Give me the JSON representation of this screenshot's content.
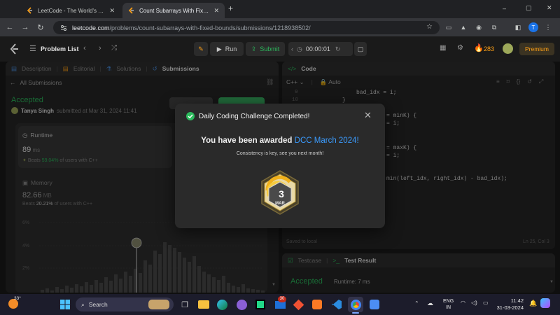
{
  "browser": {
    "tabs": [
      {
        "title": "LeetCode - The World's Leading",
        "active": false
      },
      {
        "title": "Count Subarrays With Fixed Bo",
        "active": true
      }
    ],
    "new_tab": "+",
    "url_host": "leetcode.com",
    "url_path": "/problems/count-subarrays-with-fixed-bounds/submissions/1218938502/",
    "window_controls": [
      "–",
      "▢",
      "✕"
    ],
    "profile_initial": "T"
  },
  "header": {
    "problem_list": "Problem List",
    "run": "Run",
    "submit": "Submit",
    "timer": "00:00:01",
    "streak": "283",
    "premium": "Premium"
  },
  "left": {
    "tabs": [
      "Description",
      "Editorial",
      "Solutions",
      "Submissions"
    ],
    "all_submissions": "All Submissions",
    "status": "Accepted",
    "user": "Tanya Singh",
    "submitted": "submitted at Mar 31, 2024 11:41",
    "runtime_label": "Runtime",
    "runtime_value": "89",
    "runtime_unit": "ms",
    "runtime_beats_prefix": "Beats",
    "runtime_beats_pct": "59.04%",
    "runtime_beats_suffix": "of users with C++",
    "memory_label": "Memory",
    "memory_value": "82.66",
    "memory_unit": "MB",
    "memory_beats_prefix": "Beats",
    "memory_beats_pct": "20.21%",
    "memory_beats_suffix": "of users with C++",
    "chart_ticks": [
      "6%",
      "4%",
      "2%"
    ]
  },
  "editor": {
    "title": "Code",
    "lang": "C++",
    "mode": "Auto",
    "line_numbers": [
      "9",
      "10"
    ],
    "lines": [
      "bad_idx = i;",
      "}",
      "= minK) {",
      "= i;",
      "= maxK) {",
      "= i;",
      "min(left_idx, right_idx) - bad_idx);"
    ],
    "saved": "Saved to local",
    "cursor": "Ln 25, Col 3"
  },
  "bottom": {
    "testcase": "Testcase",
    "test_result": "Test Result",
    "result_status": "Accepted",
    "result_runtime": "Runtime: 7 ms"
  },
  "modal": {
    "title": "Daily Coding Challenge Completed!",
    "award_prefix": "You have been awarded",
    "award_name": "DCC March 2024!",
    "subtitle": "Consistency is key, see you next month!",
    "badge_day": "3",
    "badge_month": "MAR"
  },
  "taskbar": {
    "weather": "33°",
    "search": "Search",
    "mail_badge": "30",
    "lang_top": "ENG",
    "lang_bottom": "IN",
    "time": "11:42",
    "date": "31-03-2024"
  },
  "colors": {
    "accent_green": "#2cbb5d",
    "link_blue": "#3b9cff",
    "premium": "#ffa116"
  }
}
